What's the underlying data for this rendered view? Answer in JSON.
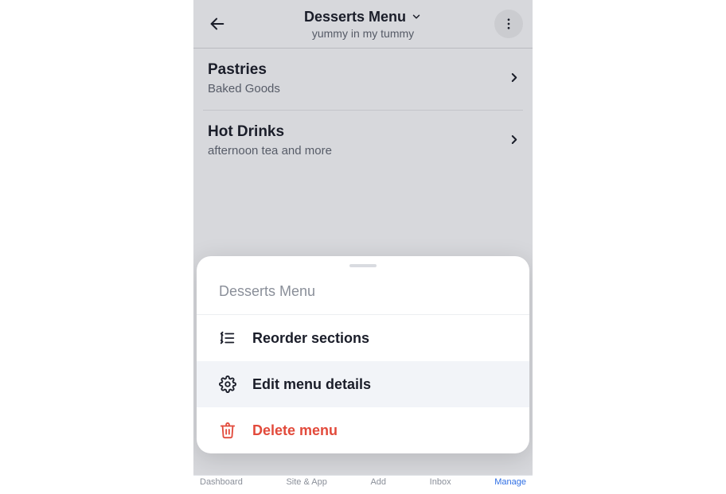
{
  "header": {
    "title": "Desserts Menu",
    "subtitle": "yummy in my tummy"
  },
  "sections": [
    {
      "title": "Pastries",
      "subtitle": "Baked Goods"
    },
    {
      "title": "Hot Drinks",
      "subtitle": "afternoon tea and more"
    }
  ],
  "sheet": {
    "title": "Desserts Menu",
    "items": [
      {
        "label": "Reorder sections"
      },
      {
        "label": "Edit menu details"
      },
      {
        "label": "Delete menu"
      }
    ]
  },
  "bottom_nav": {
    "items": [
      "Dashboard",
      "Site & App",
      "Add",
      "Inbox",
      "Manage"
    ]
  }
}
